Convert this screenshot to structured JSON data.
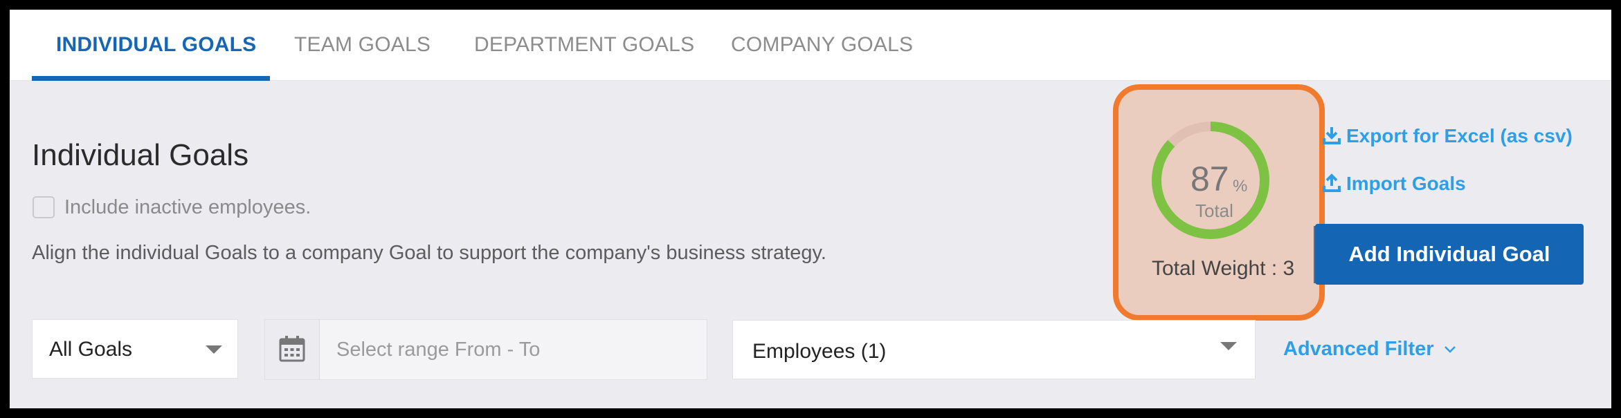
{
  "tabs": [
    {
      "label": "INDIVIDUAL GOALS",
      "active": true
    },
    {
      "label": "TEAM GOALS",
      "active": false
    },
    {
      "label": "DEPARTMENT GOALS",
      "active": false
    },
    {
      "label": "COMPANY GOALS",
      "active": false
    }
  ],
  "header": {
    "title": "Individual Goals",
    "checkbox_label": "Include inactive employees.",
    "checkbox_checked": false,
    "description": "Align the individual Goals to a company Goal to support the company's business strategy."
  },
  "progress_widget": {
    "value": "87",
    "unit": "%",
    "sublabel": "Total",
    "fraction": 0.87,
    "total_weight_label": "Total Weight : 3"
  },
  "actions": {
    "export_label": "Export for Excel (as csv)",
    "import_label": "Import Goals",
    "add_button_label": "Add Individual Goal"
  },
  "filters": {
    "goals_select_value": "All Goals",
    "date_range_placeholder": "Select range From - To",
    "employees_select_value": "Employees (1)",
    "advanced_filter_label": "Advanced Filter"
  },
  "icons": [
    "download-icon",
    "upload-icon",
    "calendar-icon",
    "chevron-down-icon",
    "caret-down-icon"
  ],
  "colors": {
    "primary": "#1666b5",
    "link": "#2e9fe6",
    "progress": "#7dc242",
    "highlight_border": "#f27a2d",
    "highlight_fill": "#ebcdc0"
  }
}
